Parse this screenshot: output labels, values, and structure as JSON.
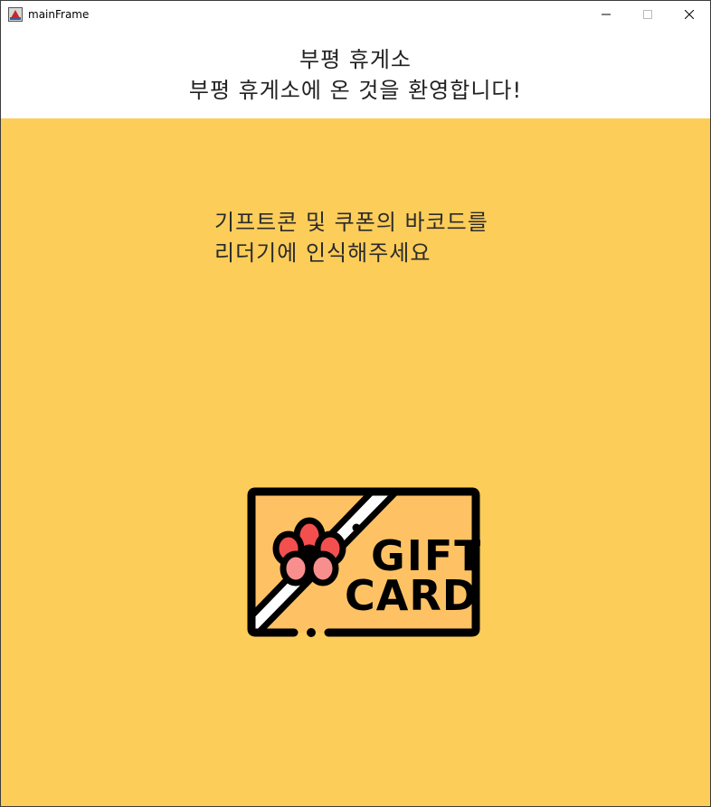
{
  "window": {
    "title": "mainFrame",
    "app_icon": "java-app-icon",
    "controls": {
      "minimize_icon": "minimize-icon",
      "maximize_icon": "maximize-icon",
      "close_icon": "close-icon"
    }
  },
  "header": {
    "title": "부평 휴게소",
    "welcome": "부평 휴게소에 온 것을 환영합니다!",
    "background": "#ffffff"
  },
  "main": {
    "background": "#fdcd5a",
    "instruction_line1": "기프트콘 및 쿠폰의 바코드를",
    "instruction_line2": "리더기에 인식해주세요",
    "illustration": {
      "icon": "gift-card-icon",
      "text_line1": "GIFT",
      "text_line2": "CARD",
      "card_color": "#fec265",
      "flower_color": "#f34f4f",
      "flower_center_color": "#f98e8e"
    }
  }
}
